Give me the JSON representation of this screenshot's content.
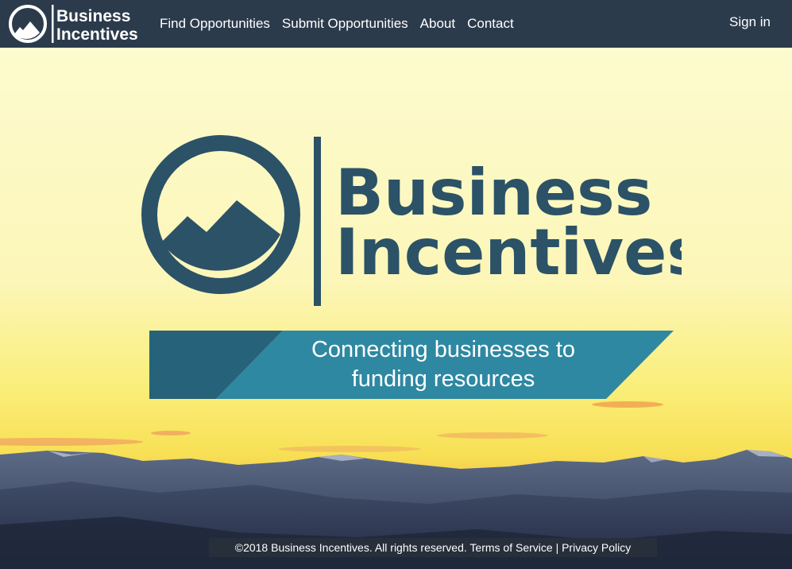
{
  "brand": {
    "line1": "Business",
    "line2": "Incentives"
  },
  "nav": {
    "links": [
      "Find Opportunities",
      "Submit Opportunities",
      "About",
      "Contact"
    ],
    "signin": "Sign in"
  },
  "hero": {
    "tagline_line1": "Connecting businesses to",
    "tagline_line2": "funding resources"
  },
  "footer": {
    "copyright": "©2018 Business Incentives. All rights reserved.",
    "terms": "Terms of Service",
    "separator": "|",
    "privacy": "Privacy Policy"
  },
  "colors": {
    "navbar": "#2c3b4c",
    "brand_dark": "#2b5267",
    "tagline_dark": "#26637a",
    "tagline_light": "#2e88a2"
  }
}
